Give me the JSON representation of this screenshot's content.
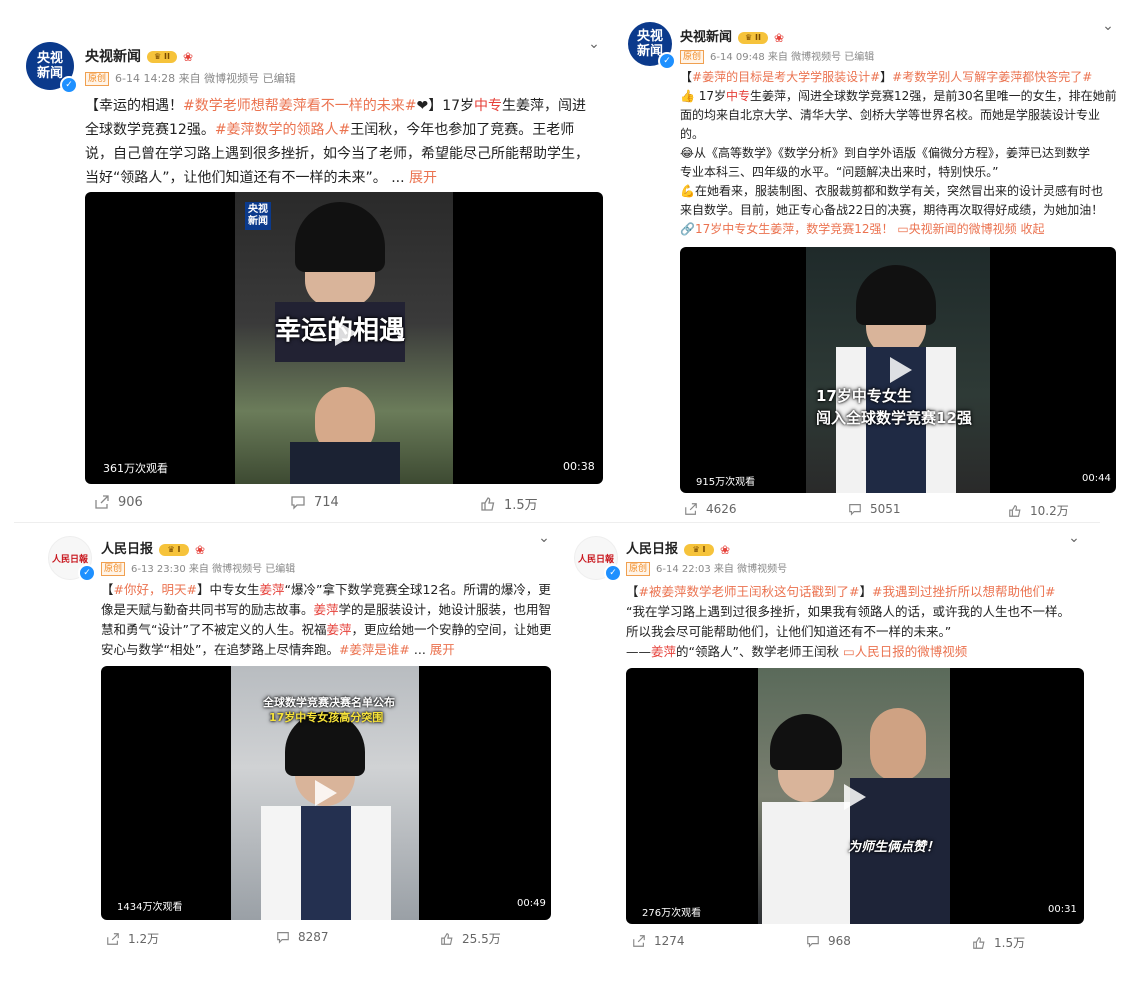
{
  "posts": [
    {
      "author": "央视新闻",
      "avatar_line1": "央视",
      "avatar_line2": "新闻",
      "original_badge": "原创",
      "meta": "6-14 14:28  来自 微博视频号 已编辑",
      "text_l1_a": "【幸运的相遇！",
      "text_l1_tag": "#数学老师想帮姜萍看不一样的未来#",
      "text_l1_b": "❤】17岁",
      "text_l1_hl": "中专",
      "text_l1_c": "生姜萍，闯进",
      "text_l2_a": "全球数学竞赛12强。",
      "text_l2_tag": "#姜萍数学的领路人#",
      "text_l2_b": "王闰秋，今年也参加了竞赛。王老师",
      "text_l3": "说，自己曾在学习路上遇到很多挫折，如今当了老师，希望能尽己所能帮助学生，",
      "text_l4": "当好“领路人”，让他们知道还有不一样的未来”。",
      "text_ellipsis": " ... ",
      "expand": "展开",
      "video_logo1": "央视",
      "video_logo2": "新闻",
      "video_caption": "幸运的相遇",
      "views": "361万次观看",
      "duration": "00:38",
      "shares": "906",
      "comments": "714",
      "likes": "1.5万"
    },
    {
      "author": "央视新闻",
      "avatar_line1": "央视",
      "avatar_line2": "新闻",
      "original_badge": "原创",
      "meta": "6-14 09:48  来自 微博视频号 已编辑",
      "tags_line_a": "【",
      "tags_line_tag1": "#姜萍的目标是考大学学服装设计#",
      "tags_line_b": "】",
      "tags_line_tag2": "#考数学别人写解字姜萍都快答完了#",
      "p1_l1_a": "👍 17岁",
      "p1_l1_hl": "中专",
      "p1_l1_b": "生姜萍，闯进全球数学竞赛12强，是前30名里唯一的女生，排在她前",
      "p1_l2": "面的均来自北京大学、清华大学、剑桥大学等世界名校。而她是学服装设计专业",
      "p1_l3": "的。",
      "p2_l1": "😂从《高等数学》《数学分析》到自学外语版《偏微分方程》，姜萍已达到数学",
      "p2_l2": "专业本科三、四年级的水平。“问题解决出来时，特别快乐。”",
      "p3_l1": "💪在她看来，服装制图、衣服裁剪都和数学有关，突然冒出来的设计灵感有时也",
      "p3_l2": "来自数学。目前，她正专心备战22日的决赛，期待再次取得好成绩，为她加油！",
      "link1": "🔗17岁中专女生姜萍，数学竞赛12强！",
      "link2": "▭央视新闻的微博视频",
      "collapse": "收起",
      "video_caption1": "17岁中专女生",
      "video_caption2": "闯入全球数学竞赛12强",
      "views": "915万次观看",
      "duration": "00:44",
      "shares": "4626",
      "comments": "5051",
      "likes": "10.2万"
    },
    {
      "author": "人民日报",
      "avatar_text": "人民日報",
      "original_badge": "原创",
      "meta": "6-13 23:30  来自 微博视频号 已编辑",
      "l1_a": "【",
      "l1_tag": "#你好，明天#",
      "l1_b": "】中专女生",
      "l1_hl": "姜萍",
      "l1_c": "“爆冷”拿下数学竞赛全球12名。所谓的爆冷，更",
      "l2": "像是天赋与勤奋共同书写的励志故事。",
      "l2_hl": "姜萍",
      "l2_b": "学的是服装设计，她设计服装，也用智",
      "l3_a": "慧和勇气“设计”了不被定义的人生。祝福",
      "l3_hl": "姜萍",
      "l3_b": "，更应给她一个安静的空间，让她更",
      "l4_a": "安心与数学“相处”，在追梦路上尽情奔跑。",
      "l4_tag": "#姜萍是谁#",
      "l4_ellipsis": " ... ",
      "expand": "展开",
      "video_caption1": "全球数学竞赛决赛名单公布",
      "video_caption2": "17岁中专女孩高分突围",
      "views": "1434万次观看",
      "duration": "00:49",
      "shares": "1.2万",
      "comments": "8287",
      "likes": "25.5万"
    },
    {
      "author": "人民日报",
      "avatar_text": "人民日報",
      "original_badge": "原创",
      "meta": "6-14 22:03  来自 微博视频号",
      "l1_a": "【",
      "l1_tag1": "#被姜萍数学老师王闰秋这句话戳到了#",
      "l1_b": "】",
      "l1_tag2": "#我遇到过挫折所以想帮助他们#",
      "l2": "“我在学习路上遇到过很多挫折，如果我有领路人的话，或许我的人生也不一样。",
      "l3": "所以我会尽可能帮助他们，让他们知道还有不一样的未来。”",
      "l4_a": "——",
      "l4_hl": "姜萍",
      "l4_b": "的“领路人”、数学老师王闰秋",
      "l4_link": "▭人民日报的微博视频",
      "video_caption": "为师生俩点赞！",
      "views": "276万次观看",
      "duration": "00:31",
      "shares": "1274",
      "comments": "968",
      "likes": "1.5万"
    }
  ]
}
